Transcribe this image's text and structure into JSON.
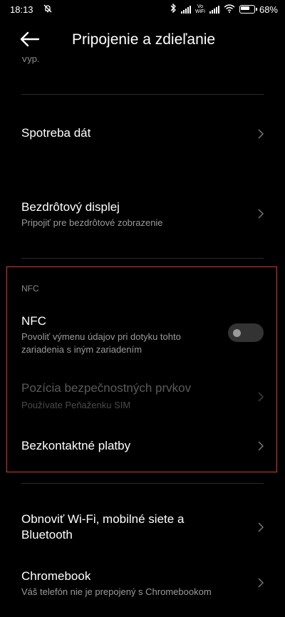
{
  "status_bar": {
    "time": "18:13",
    "battery": "68%",
    "volte_top": "Vo",
    "volte_bottom": "WiFi"
  },
  "header": {
    "title": "Pripojenie a zdieľanie"
  },
  "clipped_text": "Vyp.",
  "items": {
    "data_usage": {
      "title": "Spotreba dát"
    },
    "wireless_display": {
      "title": "Bezdrôtový displej",
      "subtitle": "Pripojiť pre bezdrôtové zobrazenie"
    },
    "nfc_section_label": "NFC",
    "nfc": {
      "title": "NFC",
      "subtitle_line1": "Povoliť výmenu údajov pri dotyku tohto",
      "subtitle_line2": "zariadenia s iným zariadením",
      "enabled": false
    },
    "secure_element": {
      "title": "Pozícia bezpečnostných prvkov",
      "subtitle": "Používate Peňaženku SIM"
    },
    "contactless": {
      "title": "Bezkontaktné platby"
    },
    "reset_network": {
      "title_line1": "Obnoviť Wi-Fi, mobilné siete a",
      "title_line2": "Bluetooth"
    },
    "chromebook": {
      "title": "Chromebook",
      "subtitle": "Váš telefón nie je prepojený s Chromebookom"
    }
  },
  "colors": {
    "background": "#000000",
    "highlight_border": "#d43a3a",
    "secondary_text": "#9a9a9a"
  }
}
